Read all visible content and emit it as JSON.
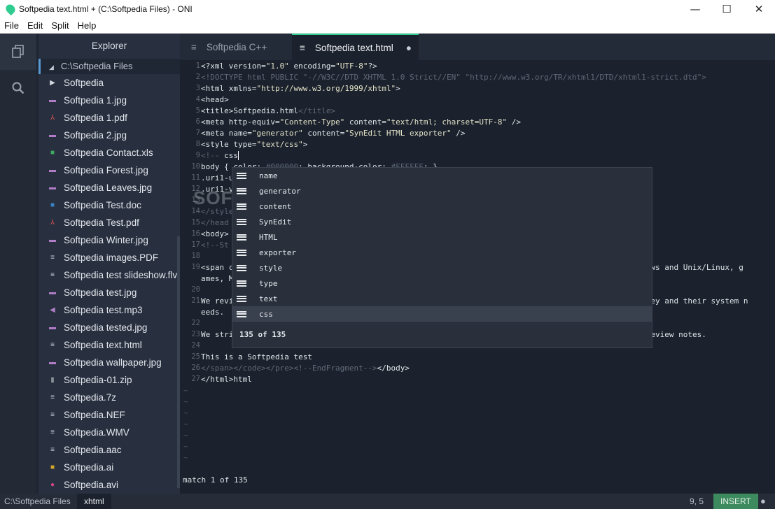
{
  "window": {
    "title": "Softpedia text.html + (C:\\Softpedia Files) - ONI",
    "minimize": "—",
    "maximize": "☐",
    "close": "✕"
  },
  "menu": [
    "File",
    "Edit",
    "Split",
    "Help"
  ],
  "explorer": {
    "title": "Explorer",
    "root": "C:\\Softpedia Files",
    "items": [
      {
        "name": "Softpedia",
        "icon": "folder-chevron-icon",
        "glyph": "▶",
        "color": "#d3d7de"
      },
      {
        "name": "Softpedia 1.jpg",
        "icon": "image-file-icon",
        "glyph": "▬",
        "color": "#b07cc6"
      },
      {
        "name": "Softpedia 1.pdf",
        "icon": "pdf-file-icon",
        "glyph": "⅄",
        "color": "#e05050"
      },
      {
        "name": "Softpedia 2.jpg",
        "icon": "image-file-icon",
        "glyph": "▬",
        "color": "#b07cc6"
      },
      {
        "name": "Softpedia Contact.xls",
        "icon": "spreadsheet-file-icon",
        "glyph": "■",
        "color": "#3fa861"
      },
      {
        "name": "Softpedia Forest.jpg",
        "icon": "image-file-icon",
        "glyph": "▬",
        "color": "#b07cc6"
      },
      {
        "name": "Softpedia Leaves.jpg",
        "icon": "image-file-icon",
        "glyph": "▬",
        "color": "#b07cc6"
      },
      {
        "name": "Softpedia Test.doc",
        "icon": "word-file-icon",
        "glyph": "■",
        "color": "#3b82c4"
      },
      {
        "name": "Softpedia Test.pdf",
        "icon": "pdf-file-icon",
        "glyph": "⅄",
        "color": "#e05050"
      },
      {
        "name": "Softpedia Winter.jpg",
        "icon": "image-file-icon",
        "glyph": "▬",
        "color": "#b07cc6"
      },
      {
        "name": "Softpedia images.PDF",
        "icon": "text-file-icon",
        "glyph": "≡",
        "color": "#c8ccd4"
      },
      {
        "name": "Softpedia test slideshow.flv",
        "icon": "text-file-icon",
        "glyph": "≡",
        "color": "#c8ccd4"
      },
      {
        "name": "Softpedia test.jpg",
        "icon": "image-file-icon",
        "glyph": "▬",
        "color": "#b07cc6"
      },
      {
        "name": "Softpedia test.mp3",
        "icon": "audio-file-icon",
        "glyph": "◀",
        "color": "#b07cc6"
      },
      {
        "name": "Softpedia tested.jpg",
        "icon": "image-file-icon",
        "glyph": "▬",
        "color": "#b07cc6"
      },
      {
        "name": "Softpedia text.html",
        "icon": "text-file-icon",
        "glyph": "≡",
        "color": "#c8ccd4"
      },
      {
        "name": "Softpedia wallpaper.jpg",
        "icon": "image-file-icon",
        "glyph": "▬",
        "color": "#b07cc6"
      },
      {
        "name": "Softpedia-01.zip",
        "icon": "archive-file-icon",
        "glyph": "▮",
        "color": "#8a8f98"
      },
      {
        "name": "Softpedia.7z",
        "icon": "text-file-icon",
        "glyph": "≡",
        "color": "#c8ccd4"
      },
      {
        "name": "Softpedia.NEF",
        "icon": "text-file-icon",
        "glyph": "≡",
        "color": "#c8ccd4"
      },
      {
        "name": "Softpedia.WMV",
        "icon": "text-file-icon",
        "glyph": "≡",
        "color": "#c8ccd4"
      },
      {
        "name": "Softpedia.aac",
        "icon": "text-file-icon",
        "glyph": "≡",
        "color": "#c8ccd4"
      },
      {
        "name": "Softpedia.ai",
        "icon": "illustrator-file-icon",
        "glyph": "■",
        "color": "#d4a72c"
      },
      {
        "name": "Softpedia.avi",
        "icon": "video-file-icon",
        "glyph": "●",
        "color": "#d6458a"
      }
    ]
  },
  "tabs": [
    {
      "label": "Softpedia C++",
      "icon": "≡"
    },
    {
      "label": "Softpedia text.html",
      "icon": "≡",
      "modified": "●"
    }
  ],
  "code": [
    {
      "n": "1",
      "html": "&lt;?xml version=<span class='str'>\"1.0\"</span> encoding=<span class='str'>\"UTF-8\"</span>?&gt;"
    },
    {
      "n": "2",
      "html": "<span class='cmt'>&lt;!DOCTYPE html PUBLIC \"-//W3C//DTD XHTML 1.0 Strict//EN\" \"http://www.w3.org/TR/xhtml1/DTD/xhtml1-strict.dtd\"&gt;</span>"
    },
    {
      "n": "3",
      "html": "&lt;html xmlns=<span class='str'>\"http://www.w3.org/1999/xhtml\"</span>&gt;"
    },
    {
      "n": "4",
      "html": "&lt;head&gt;"
    },
    {
      "n": "5",
      "html": "&lt;title&gt;Softpedia.html<span class='cmt'>&lt;/title&gt;</span>"
    },
    {
      "n": "6",
      "html": "&lt;meta http-equiv=<span class='str'>\"Content-Type\"</span> content=<span class='str'>\"text/html; charset=UTF-8\"</span> /&gt;"
    },
    {
      "n": "7",
      "html": "&lt;meta name=<span class='str'>\"generator\"</span> content=<span class='str'>\"SynEdit HTML exporter\"</span> /&gt;"
    },
    {
      "n": "8",
      "html": "&lt;style type=<span class='str'>\"text/css\"</span>&gt;"
    },
    {
      "n": "9",
      "html": "<span class='cmt'>&lt;!--</span> css<span style='border-left:1px solid #fff'></span>"
    },
    {
      "n": "10",
      "html": "body { color: <span class='cmt'>#000000</span>; background-color: <span class='cmt'>#FFFFFF</span>; }"
    },
    {
      "n": "11",
      "html": ".uri1-u"
    },
    {
      "n": "12",
      "html": ".uri1-v"
    },
    {
      "n": "13",
      "html": ""
    },
    {
      "n": "14",
      "html": "<span class='cmt'>&lt;/style</span>"
    },
    {
      "n": "15",
      "html": "<span class='cmt'>&lt;/head</span>"
    },
    {
      "n": "16",
      "html": "&lt;body&gt;"
    },
    {
      "n": "17",
      "html": "<span class='cmt'>&lt;!--St</span>"
    },
    {
      "n": "18",
      "html": ""
    },
    {
      "n": "19",
      "html": "&lt;span c                                                                                   r Windows and Unix/Linux, g"
    },
    {
      "n": "",
      "html": "ames, M"
    },
    {
      "n": "20",
      "html": ""
    },
    {
      "n": "21",
      "html": "We revi                                                                                    uct they and their system n"
    },
    {
      "n": "",
      "html": "eeds."
    },
    {
      "n": "22",
      "html": ""
    },
    {
      "n": "23",
      "html": "We stri                                                                                   n and review notes."
    },
    {
      "n": "24",
      "html": ""
    },
    {
      "n": "25",
      "html": "This is a Softpedia test"
    },
    {
      "n": "26",
      "html": "<span class='cmt'>&lt;/span&gt;&lt;/code&gt;&lt;/pre&gt;&lt;!--EndFragment--&gt;</span>&lt;/body&gt;"
    },
    {
      "n": "27",
      "html": "&lt;/html&gt;html"
    }
  ],
  "completion": {
    "items": [
      "name",
      "generator",
      "content",
      "SynEdit",
      "HTML",
      "exporter",
      "style",
      "type",
      "text",
      "css"
    ],
    "selected_index": 9,
    "footer": "135 of 135"
  },
  "watermark": "SOFTPEDIA",
  "cmdline": "match 1 of 135",
  "status": {
    "path": "C:\\Softpedia Files",
    "filetype": "xhtml",
    "position": "9, 5",
    "mode": "INSERT"
  }
}
